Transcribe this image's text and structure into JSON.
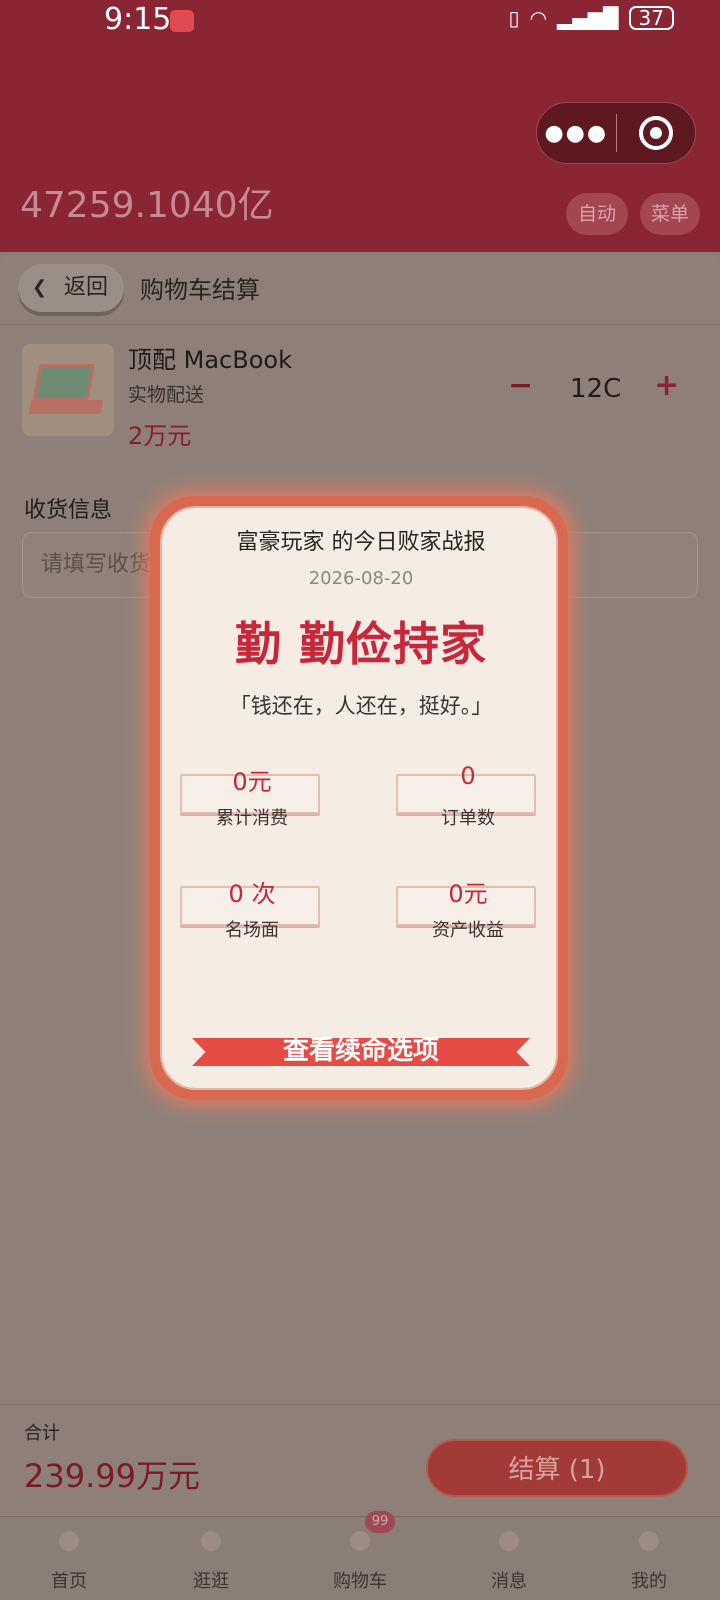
{
  "status_bar": {
    "time": "9:15",
    "battery": "37"
  },
  "header": {
    "total_assets": "47259.1040亿",
    "auto_label": "自动",
    "menu_label": "菜单"
  },
  "nav": {
    "back_label": "返回",
    "page_title": "购物车结算"
  },
  "cart_item": {
    "name": "顶配 MacBook",
    "delivery_type": "实物配送",
    "price": "2万元",
    "quantity": "12C",
    "minus": "−",
    "plus": "+"
  },
  "shipping": {
    "label": "收货信息",
    "placeholder": "请填写收货地址"
  },
  "checkout": {
    "total_label": "合计",
    "total_value": "239.99万元",
    "button_label": "结算 (1)"
  },
  "tabbar": {
    "items": [
      {
        "label": "首页"
      },
      {
        "label": "逛逛"
      },
      {
        "label": "购物车",
        "badge": "99"
      },
      {
        "label": "消息"
      },
      {
        "label": "我的"
      }
    ]
  },
  "modal": {
    "title": "富豪玩家 的今日败家战报",
    "date": "2026-08-20",
    "rank": "勤 勤俭持家",
    "quote": "「钱还在，人还在，挺好。」",
    "stats": [
      {
        "value": "0元",
        "label": "累计消费"
      },
      {
        "value": "0",
        "label": "订单数"
      },
      {
        "value": "0 次",
        "label": "名场面"
      },
      {
        "value": "0元",
        "label": "资产收益"
      }
    ],
    "button_label": "查看续命选项"
  }
}
